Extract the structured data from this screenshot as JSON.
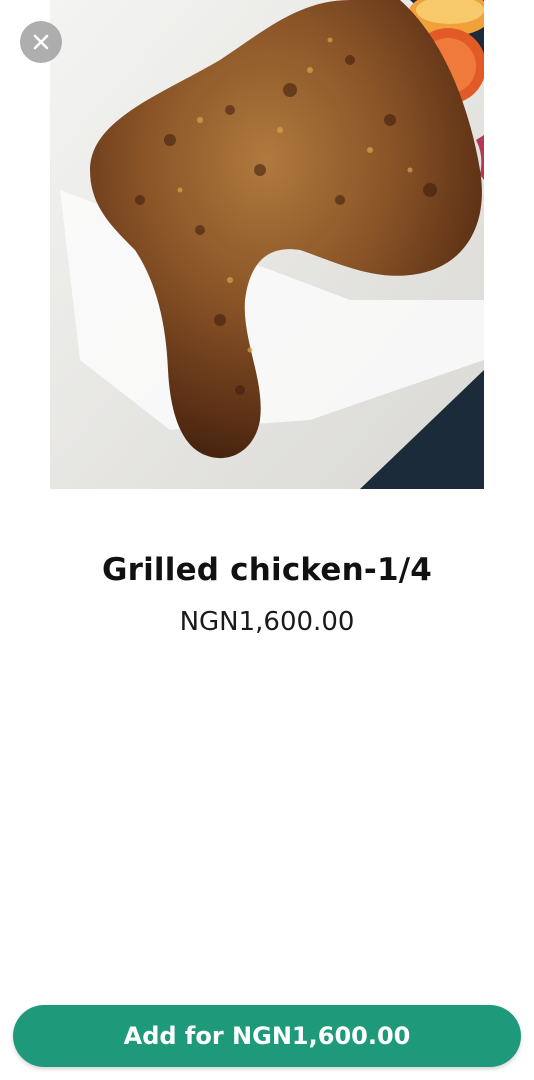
{
  "product": {
    "image_icon": "grilled-chicken-photo",
    "name": "Grilled chicken-1/4",
    "price": "NGN1,600.00"
  },
  "actions": {
    "close_icon": "close-icon",
    "add_button_label": "Add for NGN1,600.00"
  },
  "colors": {
    "accent": "#1e9a7b",
    "close_background": "#a0a0a0"
  }
}
